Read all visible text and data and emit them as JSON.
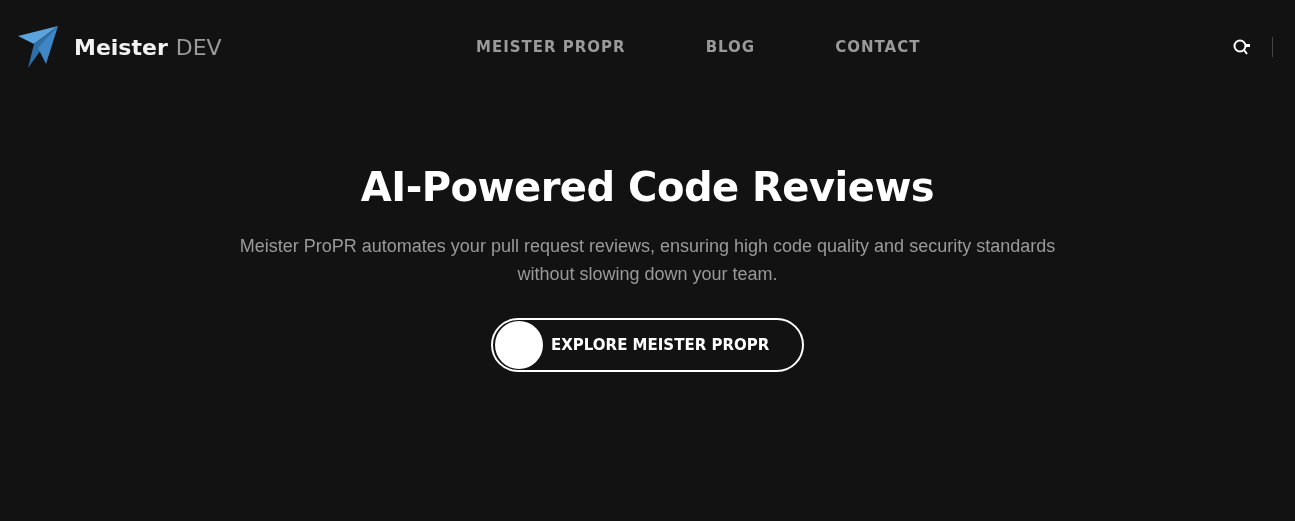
{
  "logo": {
    "name": "Meister",
    "suffix": "DEV"
  },
  "nav": [
    {
      "label": "MEISTER PROPR"
    },
    {
      "label": "BLOG"
    },
    {
      "label": "CONTACT"
    }
  ],
  "hero": {
    "title": "AI-Powered Code Reviews",
    "subtitle": "Meister ProPR automates your pull request reviews, ensuring high code quality and security standards without slowing down your team.",
    "button": "EXPLORE MEISTER PROPR"
  }
}
